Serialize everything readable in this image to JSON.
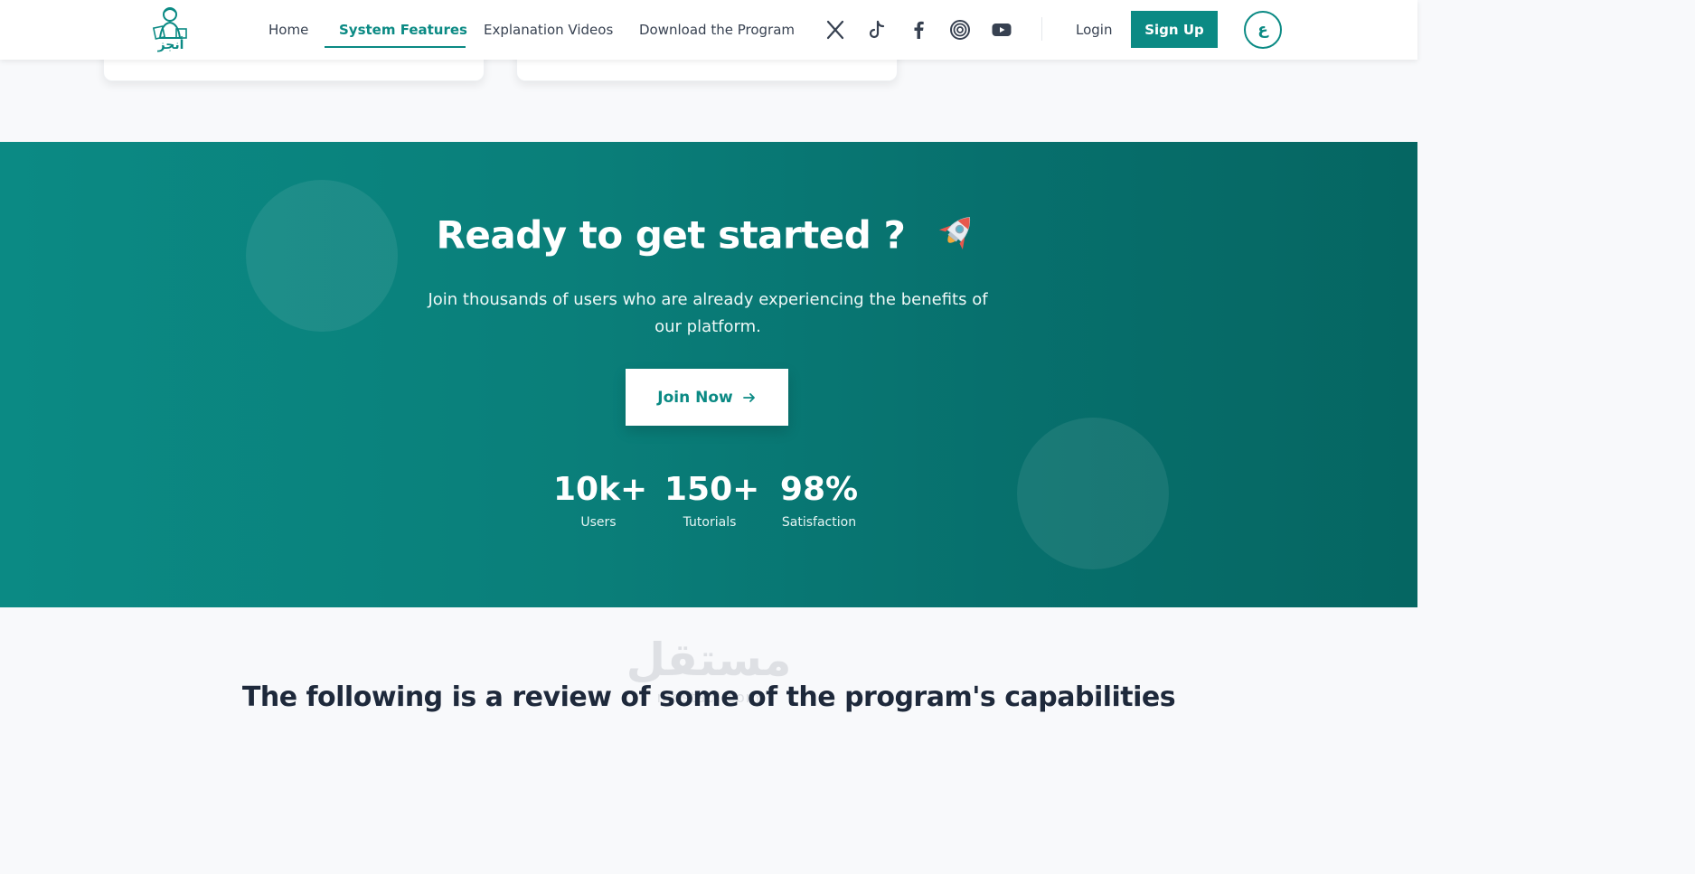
{
  "header": {
    "logo_text": "أنجز",
    "nav": [
      {
        "label": "Home"
      },
      {
        "label": "System Features",
        "active": true
      },
      {
        "label": "Explanation Videos"
      },
      {
        "label": "Download the Program"
      }
    ],
    "social_icons": [
      "x-icon",
      "tiktok-icon",
      "facebook-icon",
      "threads-icon",
      "youtube-icon"
    ],
    "login_label": "Login",
    "signup_label": "Sign Up",
    "language_toggle": "ع"
  },
  "cta": {
    "title": "Ready to get started ?",
    "subtitle": "Join thousands of users who are already experiencing the benefits of our platform.",
    "button_label": "Join Now",
    "stats": [
      {
        "value": "10k+",
        "label": "Users"
      },
      {
        "value": "150+",
        "label": "Tutorials"
      },
      {
        "value": "98%",
        "label": "Satisfaction"
      }
    ]
  },
  "watermark": {
    "text": "مستقل",
    "url": "mostaql.com"
  },
  "review": {
    "title": "The following is a review of some of the program's capabilities"
  },
  "colors": {
    "brand": "#0b8a84",
    "cta_gradient_start": "#0b8a84",
    "cta_gradient_end": "#056662",
    "heading_dark": "#1e293b"
  }
}
